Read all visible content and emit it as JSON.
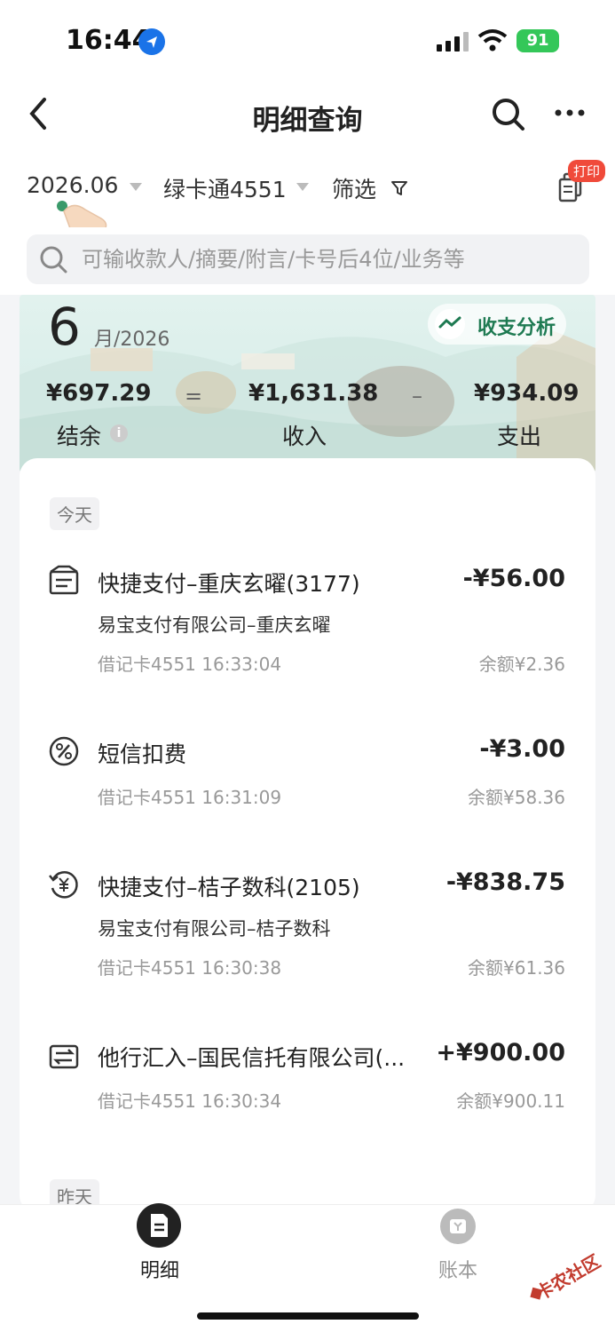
{
  "status_bar": {
    "time": "16:44",
    "battery": "91"
  },
  "nav": {
    "title": "明细查询"
  },
  "filters": {
    "date": "2026.06",
    "card": "绿卡通4551",
    "filter_label": "筛选",
    "print_badge": "打印"
  },
  "search": {
    "placeholder": "可输收款人/摘要/附言/卡号后4位/业务等"
  },
  "summary": {
    "month": "6",
    "month_suffix": "月/2026",
    "analysis_label": "收支分析",
    "balance_amount": "¥697.29",
    "balance_label": "结余",
    "equals": "=",
    "income_amount": "¥1,631.38",
    "income_label": "收入",
    "minus": "–",
    "expense_amount": "¥934.09",
    "expense_label": "支出"
  },
  "days": [
    {
      "label": "今天"
    },
    {
      "label": "昨天"
    }
  ],
  "transactions": [
    {
      "icon": "receipt-icon",
      "title": "快捷支付–重庆玄曜(3177)",
      "amount": "-¥56.00",
      "subtitle": "易宝支付有限公司–重庆玄曜",
      "meta": "借记卡4551 16:33:04",
      "balance": "余额¥2.36"
    },
    {
      "icon": "percent-icon",
      "title": "短信扣费",
      "amount": "-¥3.00",
      "subtitle": "",
      "meta": "借记卡4551 16:31:09",
      "balance": "余额¥58.36"
    },
    {
      "icon": "yuan-refresh-icon",
      "title": "快捷支付–桔子数科(2105)",
      "amount": "-¥838.75",
      "subtitle": "易宝支付有限公司–桔子数科",
      "meta": "借记卡4551 16:30:38",
      "balance": "余额¥61.36"
    },
    {
      "icon": "transfer-icon",
      "title": "他行汇入–国民信托有限公司(...",
      "amount": "+¥900.00",
      "subtitle": "",
      "meta": "借记卡4551 16:30:34",
      "balance": "余额¥900.11"
    }
  ],
  "tabs": [
    {
      "label": "明细",
      "active": true
    },
    {
      "label": "账本",
      "active": false
    }
  ],
  "watermark": "卡农社区",
  "colors": {
    "accent_green": "#1e7a52",
    "badge_red": "#f04a3a"
  }
}
